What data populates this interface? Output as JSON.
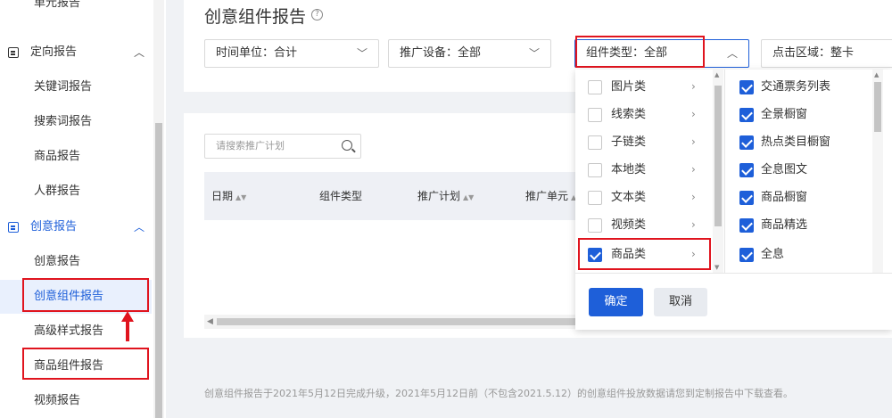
{
  "sidebar": {
    "top_partial": "单元报告",
    "groups": [
      {
        "label": "定向报告",
        "items": [
          "关键词报告",
          "搜索词报告",
          "商品报告",
          "人群报告"
        ]
      },
      {
        "label": "创意报告",
        "items": [
          "创意报告",
          "创意组件报告",
          "高级样式报告",
          "商品组件报告",
          "视频报告"
        ]
      }
    ],
    "chevron": "^"
  },
  "header": {
    "title": "创意组件报告",
    "help": "?"
  },
  "filters": {
    "time_unit": "时间单位：合计",
    "device": "推广设备：全部",
    "component_type": "组件类型：全部",
    "click_area": "点击区域：整卡"
  },
  "search": {
    "placeholder": "请搜索推广计划"
  },
  "table": {
    "columns": [
      {
        "label": "日期",
        "sortable": true
      },
      {
        "label": "组件类型",
        "sortable": false
      },
      {
        "label": "推广计划",
        "sortable": true
      },
      {
        "label": "推广单元",
        "sortable": true
      }
    ]
  },
  "dropdown": {
    "left_options": [
      {
        "label": "图片类",
        "checked": false
      },
      {
        "label": "线索类",
        "checked": false
      },
      {
        "label": "子链类",
        "checked": false
      },
      {
        "label": "本地类",
        "checked": false
      },
      {
        "label": "文本类",
        "checked": false
      },
      {
        "label": "视频类",
        "checked": false
      },
      {
        "label": "商品类",
        "checked": true
      }
    ],
    "right_options": [
      {
        "label": "交通票务列表",
        "checked": true
      },
      {
        "label": "全景橱窗",
        "checked": true
      },
      {
        "label": "热点类目橱窗",
        "checked": true
      },
      {
        "label": "全息图文",
        "checked": true
      },
      {
        "label": "商品橱窗",
        "checked": true
      },
      {
        "label": "商品精选",
        "checked": true
      },
      {
        "label": "全息",
        "checked": true
      }
    ],
    "confirm": "确定",
    "cancel": "取消"
  },
  "footer_note": "创意组件报告于2021年5月12日完成升级，2021年5月12日前（不包含2021.5.12）的创意组件投放数据请您到定制报告中下载查看。",
  "colors": {
    "accent": "#1e5fd9",
    "highlight_box": "#e0141e"
  }
}
